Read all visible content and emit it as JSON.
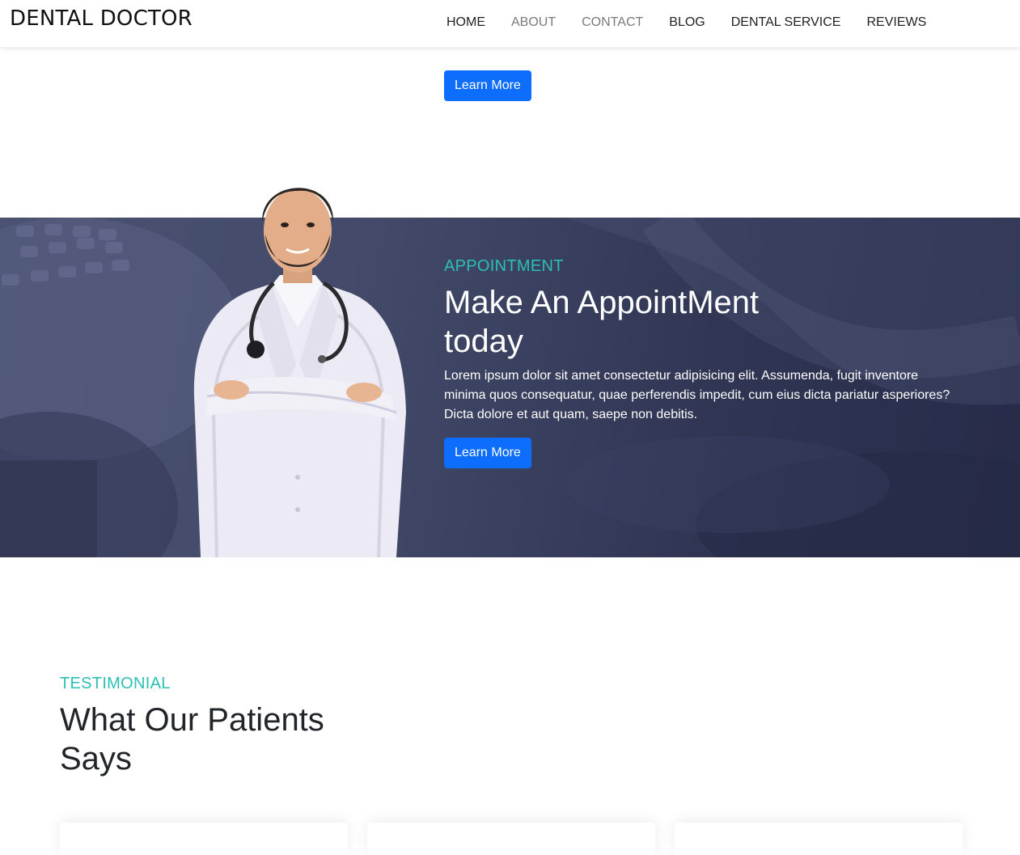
{
  "header": {
    "brand": "DENTAL DOCTOR",
    "nav": [
      {
        "label": "HOME",
        "muted": false
      },
      {
        "label": "ABOUT",
        "muted": true
      },
      {
        "label": "CONTACT",
        "muted": true
      },
      {
        "label": "BLOG",
        "muted": false
      },
      {
        "label": "DENTAL SERVICE",
        "muted": false
      },
      {
        "label": "REVIEWS",
        "muted": false
      }
    ]
  },
  "top_section": {
    "button_label": "Learn More"
  },
  "appointment": {
    "kicker": "APPOINTMENT",
    "title": "Make An AppointMent today",
    "text": "Lorem ipsum dolor sit amet consectetur adipisicing elit. Assumenda, fugit inventore minima quos consequatur, quae perferendis impedit, cum eius dicta pariatur asperiores? Dicta dolore et aut quam, saepe non debitis.",
    "button_label": "Learn More"
  },
  "testimonial": {
    "kicker": "TESTIMONIAL",
    "title": "What Our Patients Says"
  },
  "colors": {
    "accent_teal": "#2bc0b4",
    "button_blue": "#0d6efd",
    "banner_navy": "#3a405f",
    "nav_muted": "#7a7a7a"
  }
}
